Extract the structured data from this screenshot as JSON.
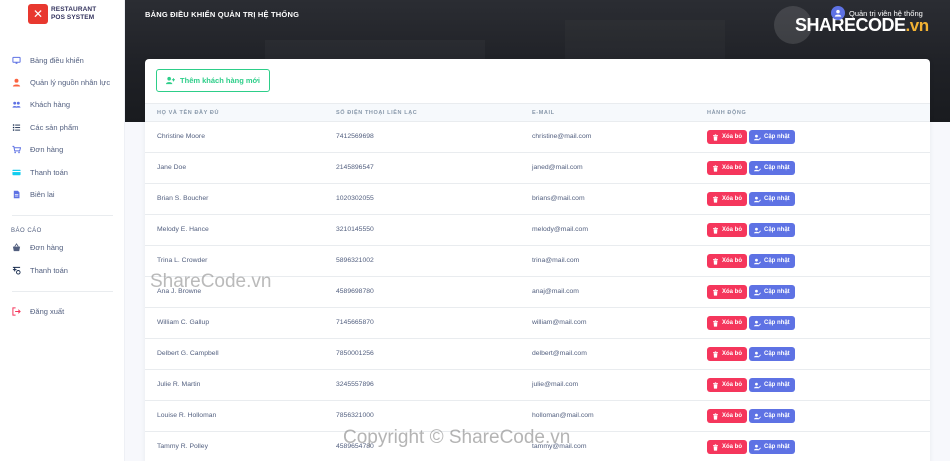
{
  "app": {
    "logo_line1": "RESTAURANT",
    "logo_line2": "POS SYSTEM",
    "page_heading": "BẢNG ĐIỀU KHIỂN QUẢN TRỊ HỆ THỐNG",
    "user_name": "Quản trị viên hệ thống"
  },
  "sidebar": {
    "items": [
      {
        "label": "Bảng điều khiển",
        "icon": "monitor-icon"
      },
      {
        "label": "Quản lý nguồn nhân lực",
        "icon": "user-icon"
      },
      {
        "label": "Khách hàng",
        "icon": "users-icon"
      },
      {
        "label": "Các sản phẩm",
        "icon": "list-icon"
      },
      {
        "label": "Đơn hàng",
        "icon": "cart-icon"
      },
      {
        "label": "Thanh toán",
        "icon": "card-icon"
      },
      {
        "label": "Biên lai",
        "icon": "receipt-icon"
      }
    ],
    "report_heading": "BÁO CÁO",
    "report_items": [
      {
        "label": "Đơn hàng",
        "icon": "basket-icon"
      },
      {
        "label": "Thanh toán",
        "icon": "cash-icon"
      }
    ],
    "logout": "Đăng xuất"
  },
  "main": {
    "add_button": "Thêm khách hàng mới",
    "columns": [
      "HỌ VÀ TÊN ĐẦY ĐỦ",
      "SỐ ĐIỆN THOẠI LIÊN LẠC",
      "E-MAIL",
      "HÀNH ĐỘNG"
    ],
    "delete_label": "Xóa bỏ",
    "update_label": "Cập nhật",
    "rows": [
      {
        "name": "Christine Moore",
        "phone": "7412569698",
        "email": "christine@mail.com"
      },
      {
        "name": "Jane Doe",
        "phone": "2145896547",
        "email": "janed@mail.com"
      },
      {
        "name": "Brian S. Boucher",
        "phone": "1020302055",
        "email": "brians@mail.com"
      },
      {
        "name": "Melody E. Hance",
        "phone": "3210145550",
        "email": "melody@mail.com"
      },
      {
        "name": "Trina L. Crowder",
        "phone": "5896321002",
        "email": "trina@mail.com"
      },
      {
        "name": "Ana J. Browne",
        "phone": "4589698780",
        "email": "anaj@mail.com"
      },
      {
        "name": "William C. Gallup",
        "phone": "7145665870",
        "email": "william@mail.com"
      },
      {
        "name": "Delbert G. Campbell",
        "phone": "7850001256",
        "email": "delbert@mail.com"
      },
      {
        "name": "Julie R. Martin",
        "phone": "3245557896",
        "email": "julie@mail.com"
      },
      {
        "name": "Louise R. Holloman",
        "phone": "7856321000",
        "email": "holloman@mail.com"
      },
      {
        "name": "Tammy R. Polley",
        "phone": "4589654780",
        "email": "tammy@mail.com"
      }
    ]
  },
  "watermarks": {
    "center": "ShareCode.vn",
    "bottom": "Copyright © ShareCode.vn",
    "brand_main": "SHARECODE",
    "brand_suffix": ".vn"
  },
  "colors": {
    "delete": "#f5365c",
    "update": "#5e72e4",
    "add": "#2dce89",
    "logo": "#e8382f"
  }
}
